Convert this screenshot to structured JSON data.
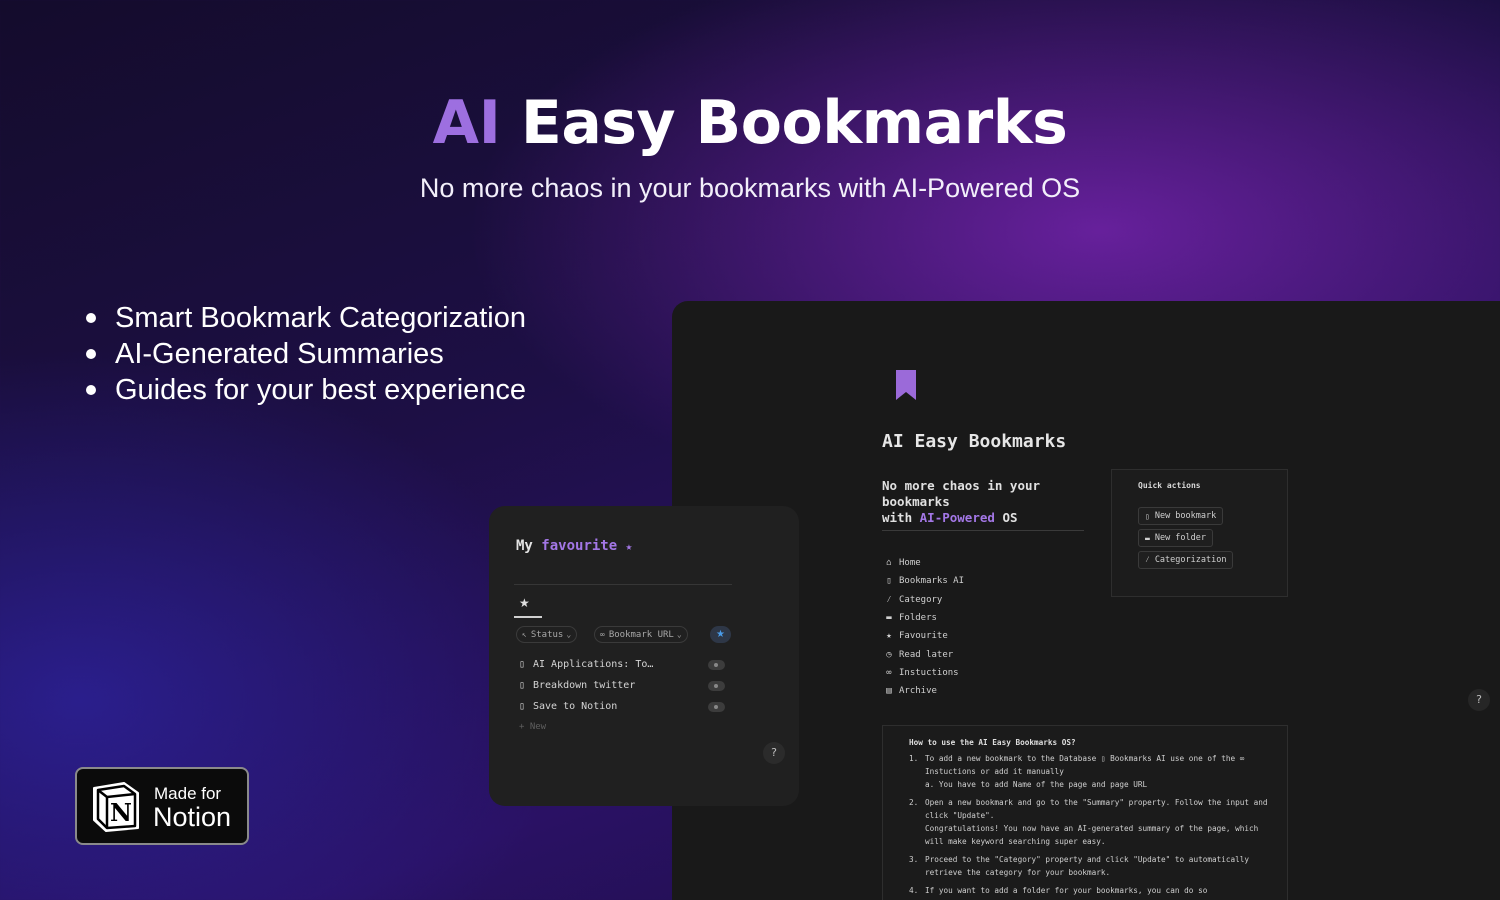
{
  "hero": {
    "title_ai": "AI",
    "title_rest": "Easy Bookmarks",
    "subtitle": "No more chaos in your bookmarks with AI-Powered OS"
  },
  "features": [
    "Smart Bookmark Categorization",
    "AI-Generated Summaries",
    "Guides for your best experience"
  ],
  "main_page": {
    "icon": "bookmark-icon",
    "title": "AI Easy Bookmarks",
    "subtitle_line1": "No more chaos in your",
    "subtitle_line2": "bookmarks",
    "subtitle_with": "with",
    "subtitle_hl": "AI-Powered",
    "subtitle_os": "OS",
    "nav": [
      {
        "icon": "home-icon",
        "glyph": "⌂",
        "label": "Home"
      },
      {
        "icon": "bookmark-icon",
        "glyph": "▯",
        "label": "Bookmarks AI"
      },
      {
        "icon": "wand-icon",
        "glyph": "⁄",
        "label": "Category"
      },
      {
        "icon": "folder-icon",
        "glyph": "▬",
        "label": "Folders"
      },
      {
        "icon": "star-icon",
        "glyph": "★",
        "label": "Favourite"
      },
      {
        "icon": "clock-icon",
        "glyph": "◷",
        "label": "Read later"
      },
      {
        "icon": "link-icon",
        "glyph": "∞",
        "label": "Instuctions"
      },
      {
        "icon": "archive-icon",
        "glyph": "▤",
        "label": "Archive"
      }
    ],
    "quick_actions": {
      "title": "Quick actions",
      "buttons": [
        {
          "icon": "bookmark-icon",
          "glyph": "▯",
          "label": "New bookmark"
        },
        {
          "icon": "folder-icon",
          "glyph": "▬",
          "label": "New folder"
        },
        {
          "icon": "wand-icon",
          "glyph": "⁄",
          "label": "Categorization"
        }
      ]
    },
    "howto": {
      "title": "How to use the AI Easy Bookmarks OS?",
      "s1_num": "1.",
      "s1_text": "To add a new bookmark to the Database  ▯ Bookmarks AI  use one of the  ∞ Instuctions  or add it manually",
      "s1a": "a. You have to add Name of the page and page URL",
      "s2_num": "2.",
      "s2_text": "Open a new bookmark and go to the \"Summary\" property. Follow the input and click \"Update\".",
      "s2_extra": "Congratulations! You now have an AI-generated summary of the page, which will make keyword searching super easy.",
      "s3_num": "3.",
      "s3_text": "Proceed to the \"Category\" property and click \"Update\" to automatically retrieve the category for your bookmark.",
      "s4_num": "4.",
      "s4_text": "If you want to add a folder for your bookmarks, you can do so"
    },
    "help_label": "?"
  },
  "favourites": {
    "title_my": "My",
    "title_fav": "favourite",
    "title_star": "★",
    "tab_icon": "★",
    "chips": [
      {
        "icon": "cursor-icon",
        "glyph": "↖",
        "label": "Status",
        "caret": "⌄"
      },
      {
        "icon": "link-icon",
        "glyph": "∞",
        "label": "Bookmark URL",
        "caret": "⌄"
      }
    ],
    "chip_star": "★",
    "rows": [
      "AI Applications: To…",
      "Breakdown twitter",
      "Save to Notion"
    ],
    "new_label": "+ New",
    "help_label": "?"
  },
  "badge": {
    "line1": "Made for",
    "line2": "Notion",
    "logo_letter": "N"
  },
  "colors": {
    "accent_purple": "#9d6fe0",
    "panel_dark": "#191919",
    "star_blue": "#4a9be8"
  }
}
